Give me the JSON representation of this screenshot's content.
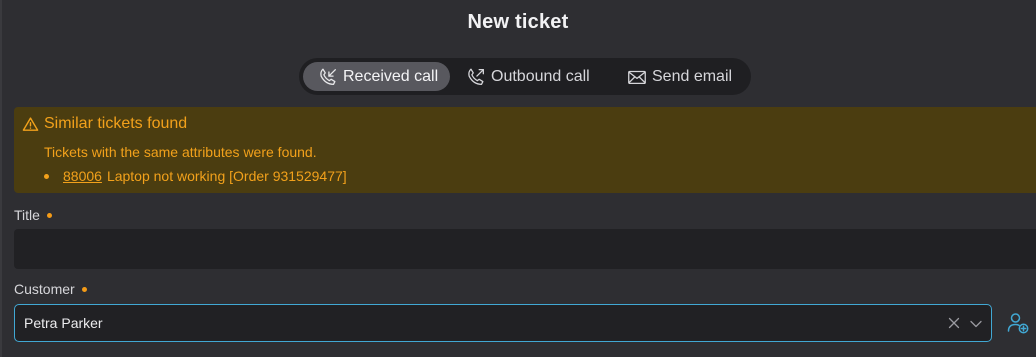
{
  "header": {
    "title": "New ticket"
  },
  "tabs": [
    {
      "label": "Received call",
      "icon": "received-call-icon",
      "active": true
    },
    {
      "label": "Outbound call",
      "icon": "outbound-call-icon",
      "active": false
    },
    {
      "label": "Send email",
      "icon": "mail-icon",
      "active": false
    }
  ],
  "alert": {
    "heading": "Similar tickets found",
    "text": "Tickets with the same attributes were found.",
    "items": [
      {
        "number": "88006",
        "title": "Laptop not working [Order 931529477]"
      }
    ]
  },
  "form": {
    "title_label": "Title",
    "title_value": "",
    "customer_label": "Customer",
    "customer_value": "Petra Parker"
  },
  "colors": {
    "background": "#2e2e32",
    "accent": "#41a8d4",
    "warning": "#f2a11b",
    "warning_bg": "#4b3d10",
    "required_dot": "#f49b17"
  }
}
